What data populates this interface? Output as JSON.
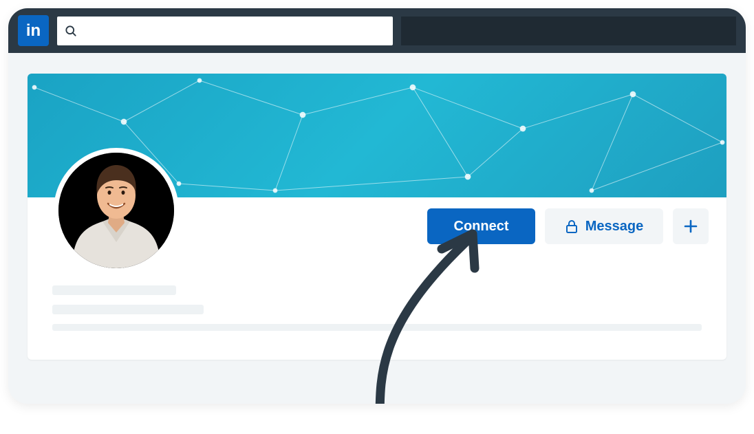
{
  "logo": {
    "text": "in"
  },
  "search": {
    "placeholder": ""
  },
  "profile": {
    "actions": {
      "connect_label": "Connect",
      "message_label": "Message"
    }
  },
  "colors": {
    "brand_primary": "#0a66c2",
    "topbar": "#2b3945",
    "topbar_dark": "#1f2a33",
    "page_bg": "#f2f5f7",
    "cover_start": "#1aa3c4",
    "cover_end": "#1e9fc0",
    "placeholder": "#eef2f4",
    "arrow": "#2b3945"
  }
}
